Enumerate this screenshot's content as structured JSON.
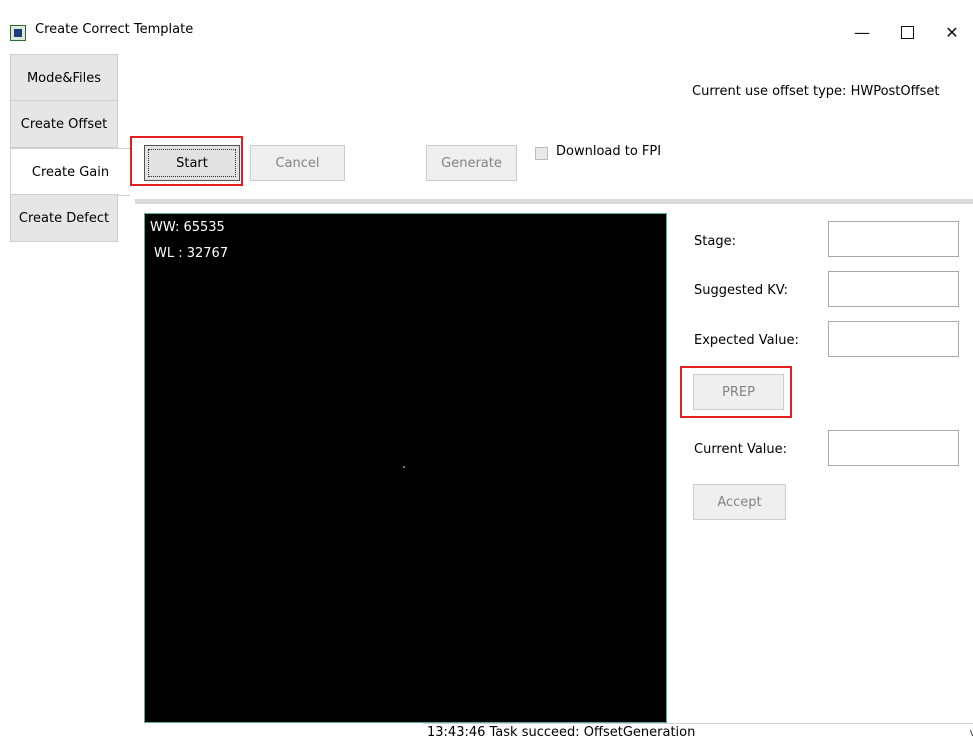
{
  "window": {
    "title": "Create Correct Template",
    "controls": {
      "minimize": "—",
      "close": "✕"
    }
  },
  "tabs": [
    {
      "label": "Mode&Files"
    },
    {
      "label": "Create Offset"
    },
    {
      "label": "Create Gain"
    },
    {
      "label": "Create Defect"
    }
  ],
  "active_tab": "Create Gain",
  "header": {
    "offset_type": "Current use offset type: HWPostOffset"
  },
  "toolbar": {
    "start_label": "Start",
    "cancel_label": "Cancel",
    "generate_label": "Generate",
    "download_label": "Download to FPI",
    "download_checked": false
  },
  "viewer": {
    "ww": "WW:  65535",
    "wl": "WL :  32767"
  },
  "fields": {
    "stage_label": "Stage:",
    "stage_value": "",
    "kv_label": "Suggested KV:",
    "kv_value": "",
    "expected_label": "Expected Value:",
    "expected_value": "",
    "current_label": "Current Value:",
    "current_value": ""
  },
  "actions": {
    "prep_label": "PREP",
    "accept_label": "Accept"
  },
  "status": {
    "message": "13:43:46 Task succeed: OffsetGeneration",
    "scroll_glyph": "v"
  },
  "colors": {
    "highlight": "#e02020",
    "viewer_bg": "#000000",
    "viewer_border": "#5aa9a0"
  }
}
